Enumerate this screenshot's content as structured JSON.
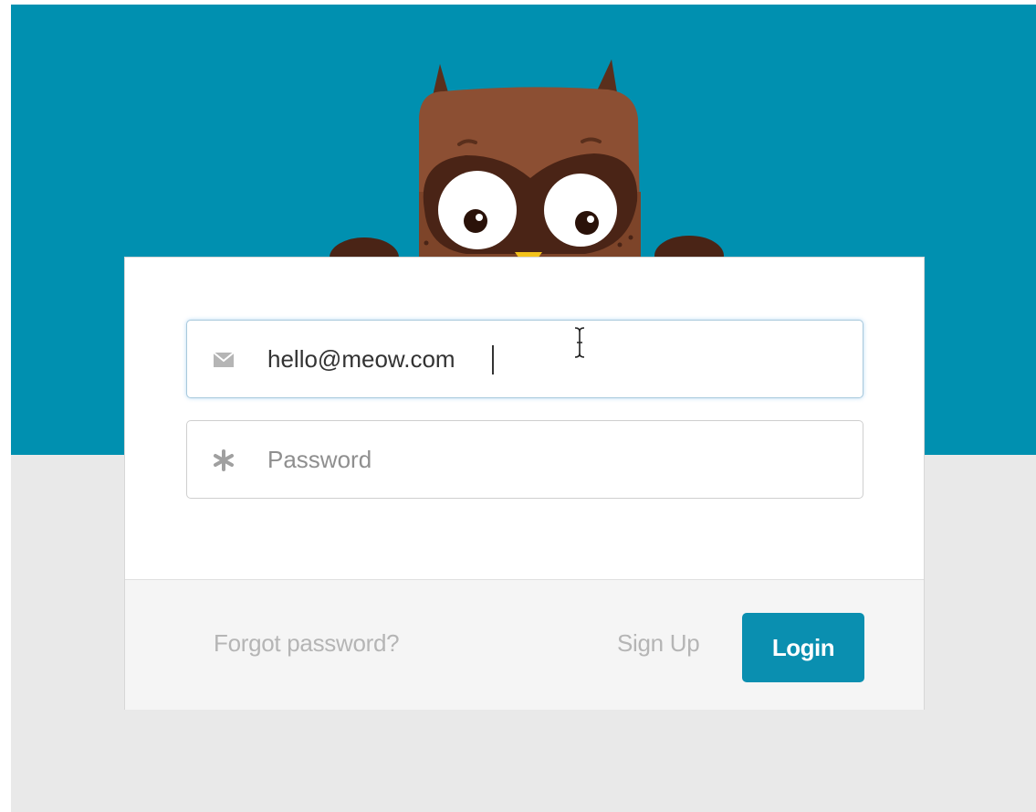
{
  "login_form": {
    "email_value": "hello@meow.com",
    "password_placeholder": "Password",
    "forgot_password_label": "Forgot password?",
    "sign_up_label": "Sign Up",
    "login_label": "Login"
  },
  "icons": {
    "email": "envelope-icon",
    "password": "asterisk-icon",
    "mascot": "owl-mascot"
  },
  "colors": {
    "hero_background": "#0090b0",
    "page_background": "#e9e9e9",
    "login_button": "#0a8fb0"
  }
}
